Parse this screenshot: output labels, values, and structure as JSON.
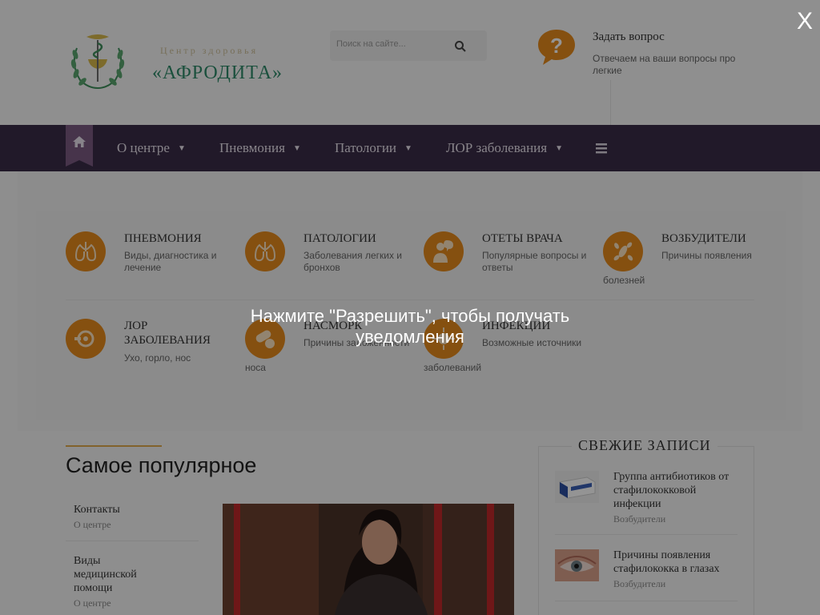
{
  "header": {
    "logo_small": "Центр здоровья",
    "logo_big": "«АФРОДИТА»",
    "search_placeholder": "Поиск на сайте...",
    "ask_title": "Задать вопрос",
    "ask_subtitle": "Отвечаем на ваши вопросы про легкие"
  },
  "nav": {
    "items": [
      {
        "label": "О центре"
      },
      {
        "label": "Пневмония"
      },
      {
        "label": "Патологии"
      },
      {
        "label": "ЛОР заболевания"
      }
    ]
  },
  "categories": [
    {
      "title": "ПНЕВМОНИЯ",
      "desc": "Виды, диагностика и лечение",
      "icon": "lungs-icon"
    },
    {
      "title": "ПАТОЛОГИИ",
      "desc": "Заболевания легких и бронхов",
      "icon": "lungs-icon"
    },
    {
      "title": "ОТЕТЫ ВРАЧА",
      "desc": "Популярные вопросы и ответы",
      "icon": "doctor-icon"
    },
    {
      "title": "ВОЗБУДИТЕЛИ",
      "desc": "Причины появления",
      "desc2": "болезней",
      "icon": "bacteria-icon"
    },
    {
      "title": "ЛОР ЗАБОЛЕВАНИЯ",
      "desc": "Ухо, горло, нос",
      "icon": "otoscope-icon"
    },
    {
      "title": "НАСМОРК",
      "desc": "Причины заложенности",
      "desc2": "носа",
      "icon": "pills-icon"
    },
    {
      "title": "ИНФЕКЦИИ",
      "desc": "Возможные источники",
      "desc2": "заболеваний",
      "icon": "virus-icon"
    }
  ],
  "popular": {
    "title": "Самое популярное",
    "items": [
      {
        "title": "Контакты",
        "category": "О центре"
      },
      {
        "title": "Виды медицинской помощи",
        "category": "О центре"
      }
    ]
  },
  "fresh": {
    "title": "СВЕЖИЕ ЗАПИСИ",
    "items": [
      {
        "title": "Группа антибиотиков от стафилококковой инфекции",
        "category": "Возбудители"
      },
      {
        "title": "Причины появления стафилококка в глазах",
        "category": "Возбудители"
      }
    ]
  },
  "overlay": {
    "message": "Нажмите \"Разрешить\", чтобы получать уведомления",
    "close_label": "X"
  },
  "colors": {
    "nav_bg": "#3a2c48",
    "accent_orange": "#e58a1c",
    "logo_green": "#2f8a6a"
  }
}
